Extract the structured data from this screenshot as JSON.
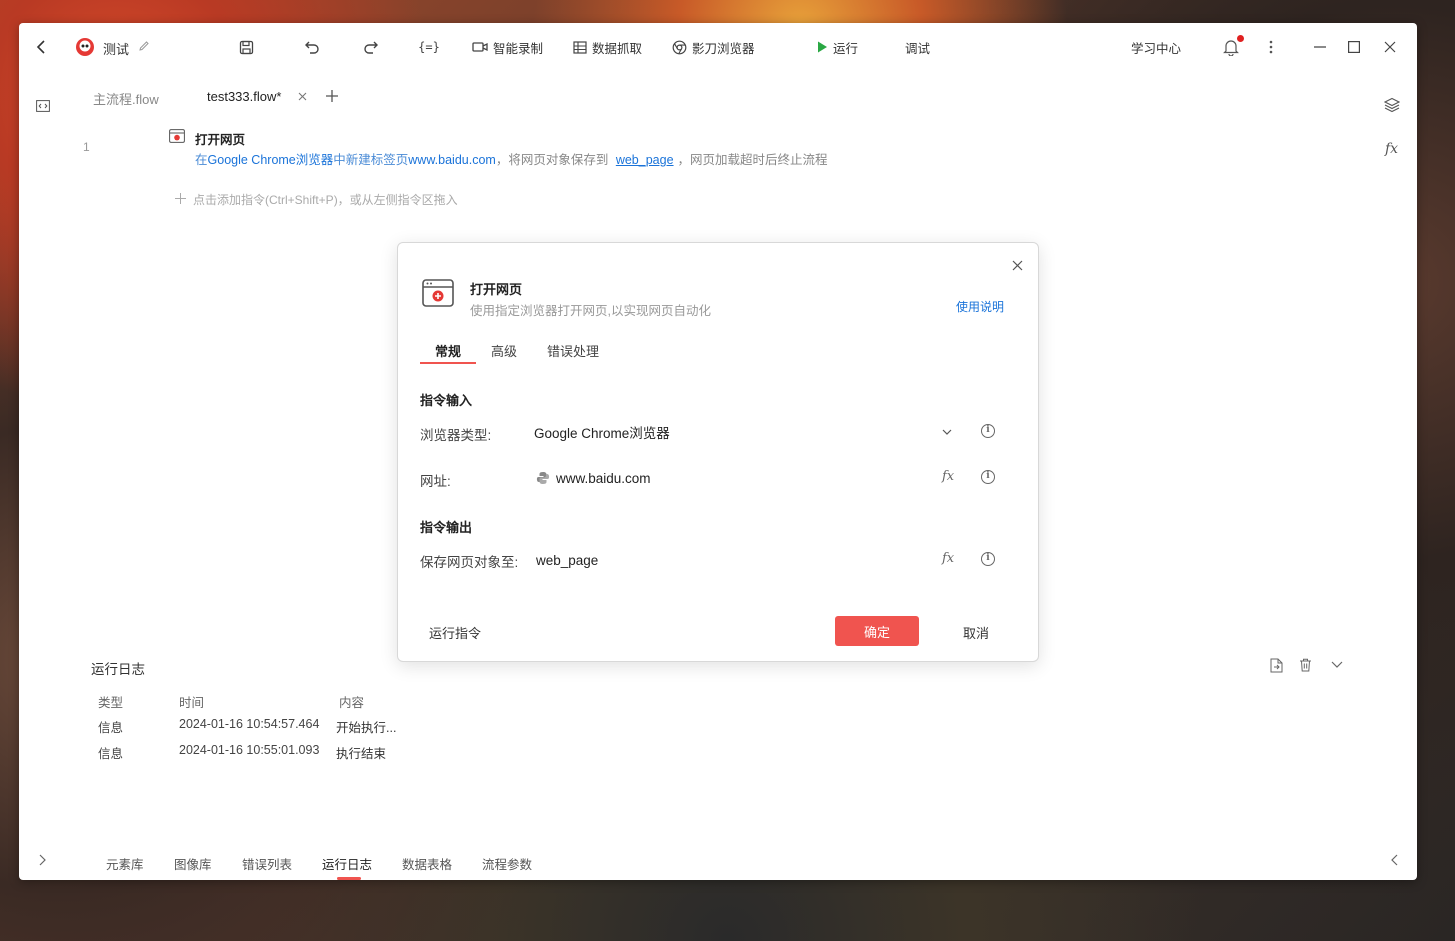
{
  "app": {
    "title": "测试",
    "toolbar": {
      "smart_record": "智能录制",
      "data_scrape": "数据抓取",
      "browser": "影刀浏览器",
      "run": "运行",
      "debug": "调试",
      "learning_center": "学习中心"
    }
  },
  "tabs": [
    {
      "label": "主流程.flow",
      "active": false
    },
    {
      "label": "test333.flow*",
      "active": true
    }
  ],
  "flow": {
    "line_number": "1",
    "step_title": "打开网页",
    "desc": {
      "p1": "在",
      "browser": "Google Chrome浏览器",
      "p2": "中新建标签页",
      "url": "www.baidu.com",
      "p3": "，将网页对象保存到",
      "var": "web_page",
      "p4": "，网页加载超时后终止流程"
    },
    "add_hint": "点击添加指令(Ctrl+Shift+P)，或从左侧指令区拖入"
  },
  "modal": {
    "title": "打开网页",
    "subtitle": "使用指定浏览器打开网页,以实现网页自动化",
    "help_link": "使用说明",
    "tabs": [
      "常规",
      "高级",
      "错误处理"
    ],
    "input_section": "指令输入",
    "browser_type_label": "浏览器类型:",
    "browser_type_value": "Google Chrome浏览器",
    "url_label": "网址:",
    "url_value": "www.baidu.com",
    "output_section": "指令输出",
    "save_label": "保存网页对象至:",
    "save_value": "web_page",
    "run_command": "运行指令",
    "confirm": "确定",
    "cancel": "取消"
  },
  "log": {
    "title": "运行日志",
    "headers": [
      "类型",
      "时间",
      "内容"
    ],
    "rows": [
      {
        "type": "信息",
        "time": "2024-01-16 10:54:57.464",
        "content": "开始执行..."
      },
      {
        "type": "信息",
        "time": "2024-01-16 10:55:01.093",
        "content": "执行结束"
      }
    ]
  },
  "bottom_tabs": [
    "元素库",
    "图像库",
    "错误列表",
    "运行日志",
    "数据表格",
    "流程参数"
  ],
  "colors": {
    "accent": "#f0544f",
    "link": "#1a73d9",
    "run_green": "#2aa844",
    "notification_dot": "#e02020"
  }
}
